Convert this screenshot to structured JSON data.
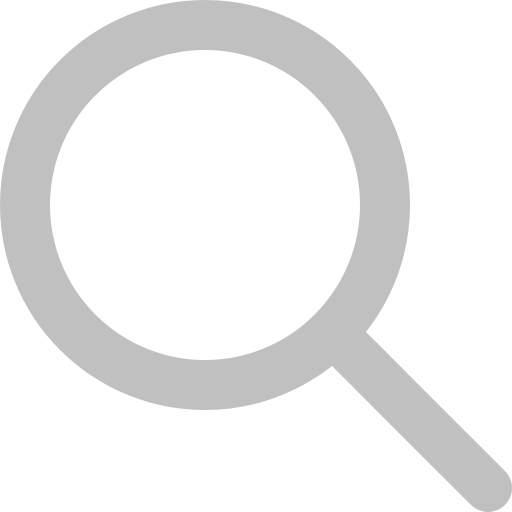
{
  "icon": {
    "name": "search-icon",
    "color": "#c0c0c0",
    "background": "#ffffff"
  }
}
